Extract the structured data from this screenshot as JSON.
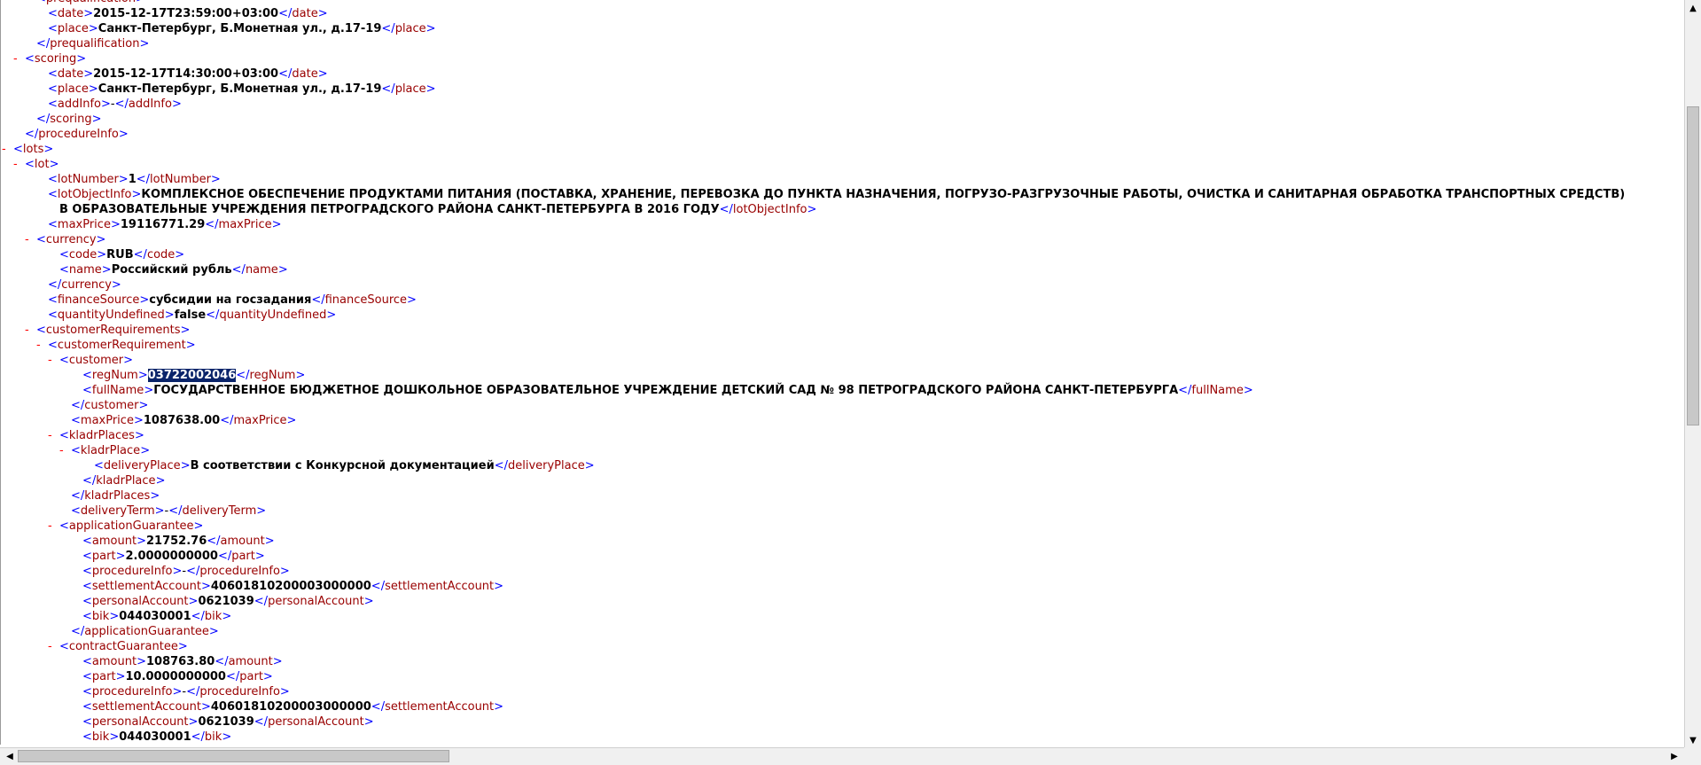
{
  "colors": {
    "tag": "#990000",
    "bracket": "#0000ff",
    "value": "#000000",
    "expander": "#ff0000",
    "selection": "#0a246a"
  },
  "lines": [
    {
      "i": 3,
      "open": "prequalification",
      "mk": "-"
    },
    {
      "i": 4,
      "open": "date",
      "v": "2015-12-17T23:59:00+03:00",
      "close": "date"
    },
    {
      "i": 4,
      "open": "place",
      "v": "Санкт-Петербург, Б.Монетная ул., д.17-19",
      "close": "place"
    },
    {
      "i": 3,
      "close": "prequalification"
    },
    {
      "i": 2,
      "mk": "-",
      "open": "scoring"
    },
    {
      "i": 4,
      "open": "date",
      "v": "2015-12-17T14:30:00+03:00",
      "close": "date"
    },
    {
      "i": 4,
      "open": "place",
      "v": "Санкт-Петербург, Б.Монетная ул., д.17-19",
      "close": "place"
    },
    {
      "i": 4,
      "open": "addInfo",
      "v": "-",
      "close": "addInfo",
      "vplain": true
    },
    {
      "i": 3,
      "close": "scoring"
    },
    {
      "i": 2,
      "close": "procedureInfo"
    },
    {
      "i": 1,
      "mk": "-",
      "open": "lots"
    },
    {
      "i": 2,
      "mk": "-",
      "open": "lot"
    },
    {
      "i": 4,
      "open": "lotNumber",
      "v": "1",
      "close": "lotNumber"
    },
    {
      "i": 4,
      "open": "lotObjectInfo",
      "v": "КОМПЛЕКСНОЕ ОБЕСПЕЧЕНИЕ ПРОДУКТАМИ ПИТАНИЯ (ПОСТАВКА, ХРАНЕНИЕ, ПЕРЕВОЗКА ДО ПУНКТА НАЗНАЧЕНИЯ, ПОГРУЗО-РАЗГРУЗОЧНЫЕ РАБОТЫ, ОЧИСТКА И САНИТАРНАЯ ОБРАБОТКА ТРАНСПОРТНЫХ СРЕДСТВ)"
    },
    {
      "i": 5,
      "v": "В ОБРАЗОВАТЕЛЬНЫЕ УЧРЕЖДЕНИЯ ПЕТРОГРАДСКОГО РАЙОНА САНКТ-ПЕТЕРБУРГА В 2016 ГОДУ",
      "close": "lotObjectInfo"
    },
    {
      "i": 4,
      "open": "maxPrice",
      "v": "19116771.29",
      "close": "maxPrice"
    },
    {
      "i": 3,
      "mk": "-",
      "open": "currency"
    },
    {
      "i": 5,
      "open": "code",
      "v": "RUB",
      "close": "code"
    },
    {
      "i": 5,
      "open": "name",
      "v": "Российский рубль",
      "close": "name"
    },
    {
      "i": 4,
      "close": "currency"
    },
    {
      "i": 4,
      "open": "financeSource",
      "v": "субсидии на госзадания",
      "close": "financeSource"
    },
    {
      "i": 4,
      "open": "quantityUndefined",
      "v": "false",
      "close": "quantityUndefined"
    },
    {
      "i": 3,
      "mk": "-",
      "open": "customerRequirements"
    },
    {
      "i": 4,
      "mk": "-",
      "open": "customerRequirement"
    },
    {
      "i": 5,
      "mk": "-",
      "open": "customer"
    },
    {
      "i": 7,
      "open": "regNum",
      "v": "03722002046",
      "close": "regNum",
      "sel": true
    },
    {
      "i": 7,
      "open": "fullName",
      "v": "ГОСУДАРСТВЕННОЕ БЮДЖЕТНОЕ ДОШКОЛЬНОЕ ОБРАЗОВАТЕЛЬНОЕ УЧРЕЖДЕНИЕ ДЕТСКИЙ САД № 98 ПЕТРОГРАДСКОГО РАЙОНА САНКТ-ПЕТЕРБУРГА",
      "close": "fullName"
    },
    {
      "i": 6,
      "close": "customer"
    },
    {
      "i": 6,
      "open": "maxPrice",
      "v": "1087638.00",
      "close": "maxPrice"
    },
    {
      "i": 5,
      "mk": "-",
      "open": "kladrPlaces"
    },
    {
      "i": 6,
      "mk": "-",
      "open": "kladrPlace"
    },
    {
      "i": 8,
      "open": "deliveryPlace",
      "v": "В соответствии с Конкурсной документацией",
      "close": "deliveryPlace"
    },
    {
      "i": 7,
      "close": "kladrPlace"
    },
    {
      "i": 6,
      "close": "kladrPlaces"
    },
    {
      "i": 6,
      "open": "deliveryTerm",
      "v": "-",
      "close": "deliveryTerm",
      "vplain": true
    },
    {
      "i": 5,
      "mk": "-",
      "open": "applicationGuarantee"
    },
    {
      "i": 7,
      "open": "amount",
      "v": "21752.76",
      "close": "amount"
    },
    {
      "i": 7,
      "open": "part",
      "v": "2.0000000000",
      "close": "part"
    },
    {
      "i": 7,
      "open": "procedureInfo",
      "v": "-",
      "close": "procedureInfo",
      "vplain": true
    },
    {
      "i": 7,
      "open": "settlementAccount",
      "v": "40601810200003000000",
      "close": "settlementAccount"
    },
    {
      "i": 7,
      "open": "personalAccount",
      "v": "0621039",
      "close": "personalAccount"
    },
    {
      "i": 7,
      "open": "bik",
      "v": "044030001",
      "close": "bik"
    },
    {
      "i": 6,
      "close": "applicationGuarantee"
    },
    {
      "i": 5,
      "mk": "-",
      "open": "contractGuarantee"
    },
    {
      "i": 7,
      "open": "amount",
      "v": "108763.80",
      "close": "amount"
    },
    {
      "i": 7,
      "open": "part",
      "v": "10.0000000000",
      "close": "part"
    },
    {
      "i": 7,
      "open": "procedureInfo",
      "v": "-",
      "close": "procedureInfo",
      "vplain": true
    },
    {
      "i": 7,
      "open": "settlementAccount",
      "v": "40601810200003000000",
      "close": "settlementAccount"
    },
    {
      "i": 7,
      "open": "personalAccount",
      "v": "0621039",
      "close": "personalAccount"
    },
    {
      "i": 7,
      "open": "bik",
      "v": "044030001",
      "close": "bik"
    },
    {
      "i": 6,
      "close": "contractGuarantee"
    }
  ],
  "scrollbars": {
    "up_icon": "▲",
    "down_icon": "▼",
    "left_icon": "◀",
    "right_icon": "▶"
  }
}
